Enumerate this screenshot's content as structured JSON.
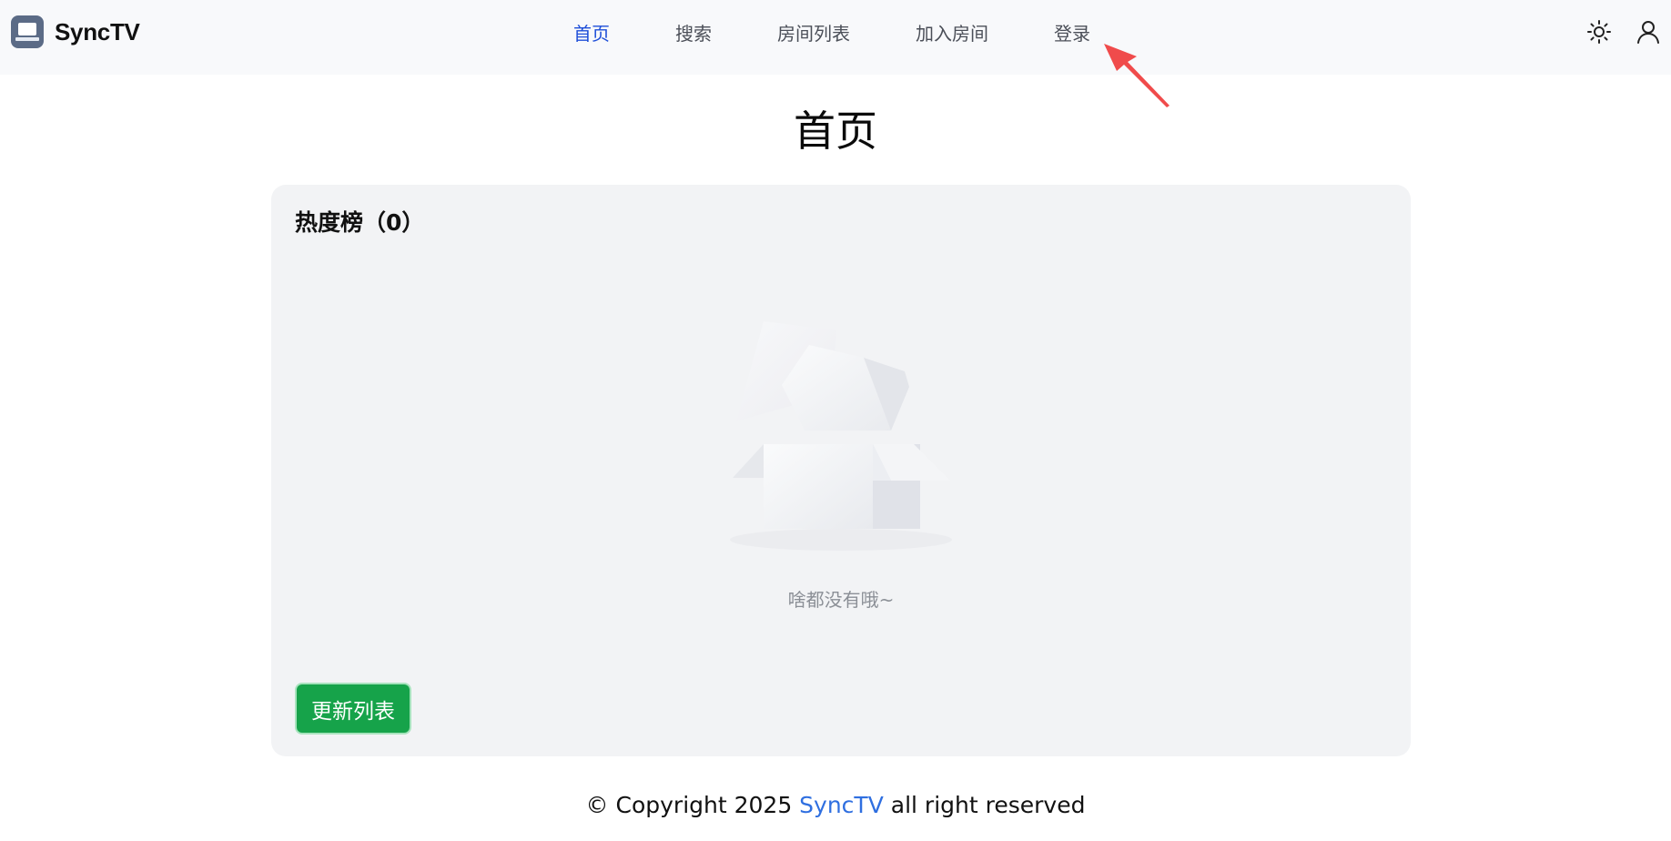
{
  "brand": {
    "name": "SyncTV"
  },
  "nav": {
    "items": [
      {
        "label": "首页",
        "active": true
      },
      {
        "label": "搜索",
        "active": false
      },
      {
        "label": "房间列表",
        "active": false
      },
      {
        "label": "加入房间",
        "active": false
      },
      {
        "label": "登录",
        "active": false
      }
    ]
  },
  "header_icons": [
    "sun-icon",
    "user-icon"
  ],
  "main": {
    "title": "首页",
    "card": {
      "title": "热度榜（0）",
      "empty_text": "啥都没有哦~",
      "refresh_label": "更新列表"
    }
  },
  "footer": {
    "prefix": "© Copyright 2025 ",
    "link": "SyncTV",
    "suffix": " all right reserved"
  },
  "colors": {
    "accent": "#1d4ed8",
    "button_green": "#16a34a",
    "link_blue": "#2f6fe0",
    "annotation_red": "#f04b4b"
  }
}
